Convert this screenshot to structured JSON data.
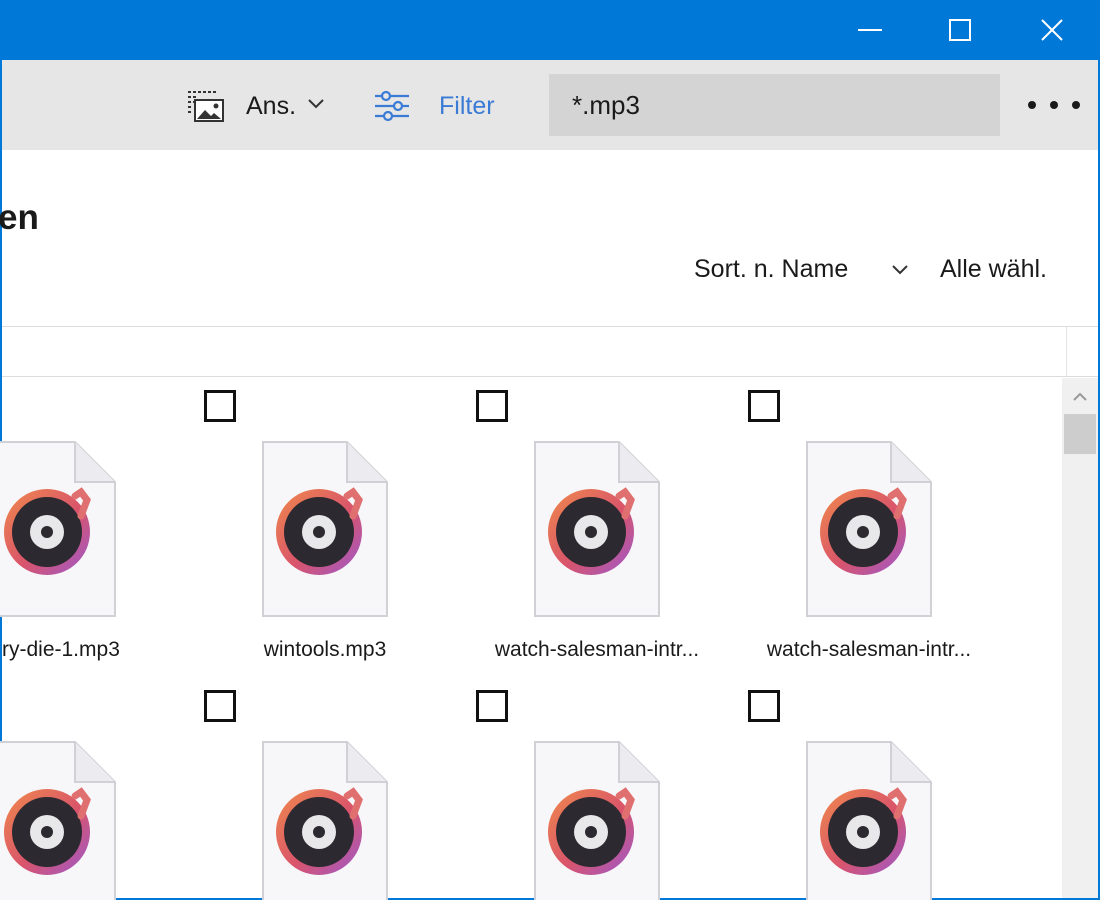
{
  "window": {
    "minimize_icon": "minimize-icon",
    "maximize_icon": "maximize-icon",
    "close_icon": "close-icon",
    "titlebar_color": "#0078d7"
  },
  "toolbar": {
    "view_icon": "view-gallery-icon",
    "view_label": "Ans.",
    "view_chevron_icon": "chevron-down-icon",
    "filter_icon": "filter-sliders-icon",
    "filter_label": "Filter",
    "filter_color": "#3a7bd5",
    "search_value": "*.mp3",
    "more_icon": "more-dots-icon"
  },
  "header": {
    "title": "en",
    "sort_label": "Sort. n. Name",
    "sort_chevron_icon": "chevron-down-icon",
    "select_all_label": "Alle wähl."
  },
  "files": [
    {
      "name": "ry-die-1.mp3",
      "checkbox_visible": false,
      "icon": "music-file-icon"
    },
    {
      "name": "wintools.mp3",
      "checkbox_visible": true,
      "icon": "music-file-icon"
    },
    {
      "name": "watch-salesman-intr...",
      "checkbox_visible": true,
      "icon": "music-file-icon"
    },
    {
      "name": "watch-salesman-intr...",
      "checkbox_visible": true,
      "icon": "music-file-icon"
    },
    {
      "name": "",
      "checkbox_visible": false,
      "icon": "music-file-icon"
    },
    {
      "name": "",
      "checkbox_visible": true,
      "icon": "music-file-icon"
    },
    {
      "name": "",
      "checkbox_visible": true,
      "icon": "music-file-icon"
    },
    {
      "name": "",
      "checkbox_visible": true,
      "icon": "music-file-icon"
    }
  ]
}
